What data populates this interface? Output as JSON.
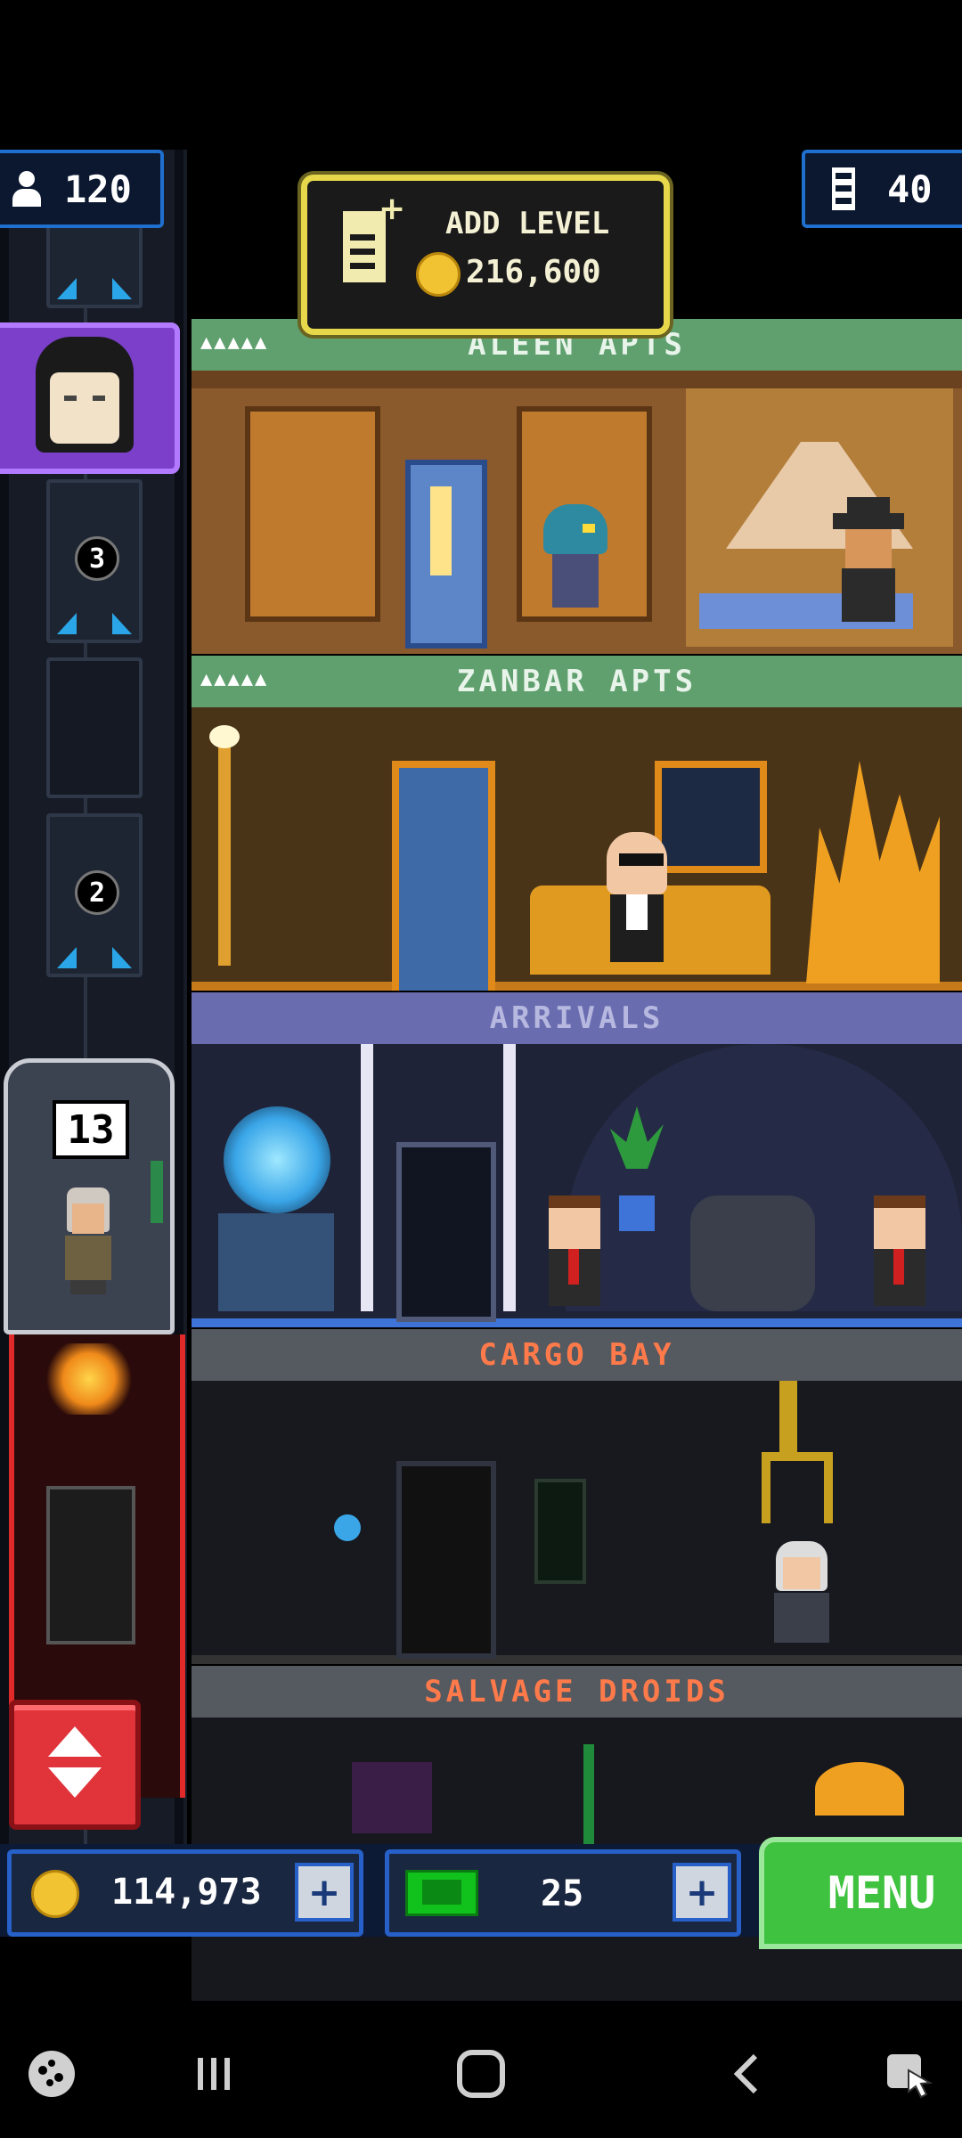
{
  "hud": {
    "population": "120",
    "floors": "40",
    "add_level_label": "ADD LEVEL",
    "add_level_cost": "216,600"
  },
  "elevator": {
    "stops": [
      "3",
      "2"
    ],
    "car_floor": "13"
  },
  "floors": [
    {
      "name": "ALEEN APTS",
      "stars": "▲▲▲▲▲"
    },
    {
      "name": "ZANBAR APTS",
      "stars": "▲▲▲▲▲"
    },
    {
      "name": "ARRIVALS"
    },
    {
      "name": "CARGO BAY"
    },
    {
      "name": "SALVAGE DROIDS"
    }
  ],
  "bottom_bar": {
    "coins": "114,973",
    "bux": "25",
    "menu_label": "MENU"
  },
  "colors": {
    "residential_sign": "#5fa06e",
    "arrivals_sign": "#6a6cb0",
    "service_sign": "#555a60",
    "service_text": "#ff7a4a",
    "gold": "#f1c232",
    "menu_green": "#3fc23f"
  },
  "nav": {
    "icons": [
      "game-launcher-icon",
      "recent-apps-icon",
      "home-icon",
      "back-icon",
      "screenshot-assist-icon"
    ]
  }
}
